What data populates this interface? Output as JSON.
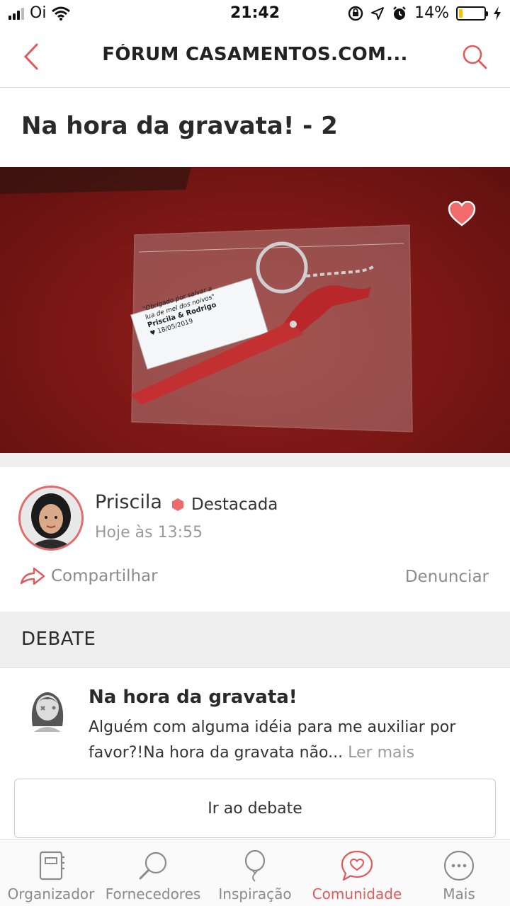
{
  "status_bar": {
    "carrier": "Oi",
    "time": "21:42",
    "battery": "14%"
  },
  "header": {
    "title": "FÓRUM CASAMENTOS.COM..."
  },
  "post": {
    "title": "Na hora da gravata! - 2",
    "photo_card_lines": [
      "\"Obrigado por salvar a",
      "lua de mel dos noivos\"",
      "Priscila & Rodrigo",
      "♥ 18/05/2019"
    ],
    "author": {
      "name": "Priscila",
      "badge": "Destacada",
      "time": "Hoje às 13:55"
    },
    "actions": {
      "share": "Compartilhar",
      "report": "Denunciar"
    }
  },
  "debate": {
    "section_label": "DEBATE",
    "title": "Na hora da gravata!",
    "excerpt": "Alguém com alguma idéia para me auxiliar por favor?!Na hora da gravata não...",
    "read_more": "Ler mais",
    "go_button": "Ir ao debate"
  },
  "bottom_nav": {
    "items": [
      {
        "label": "Organizador",
        "icon": "planner-icon",
        "active": false
      },
      {
        "label": "Fornecedores",
        "icon": "magnifier-icon",
        "active": false
      },
      {
        "label": "Inspiração",
        "icon": "balloon-icon",
        "active": false
      },
      {
        "label": "Comunidade",
        "icon": "chat-heart-icon",
        "active": true
      },
      {
        "label": "Mais",
        "icon": "more-icon",
        "active": false
      }
    ]
  },
  "colors": {
    "accent": "#e05a5a",
    "battery_fill": "#f5c400"
  }
}
